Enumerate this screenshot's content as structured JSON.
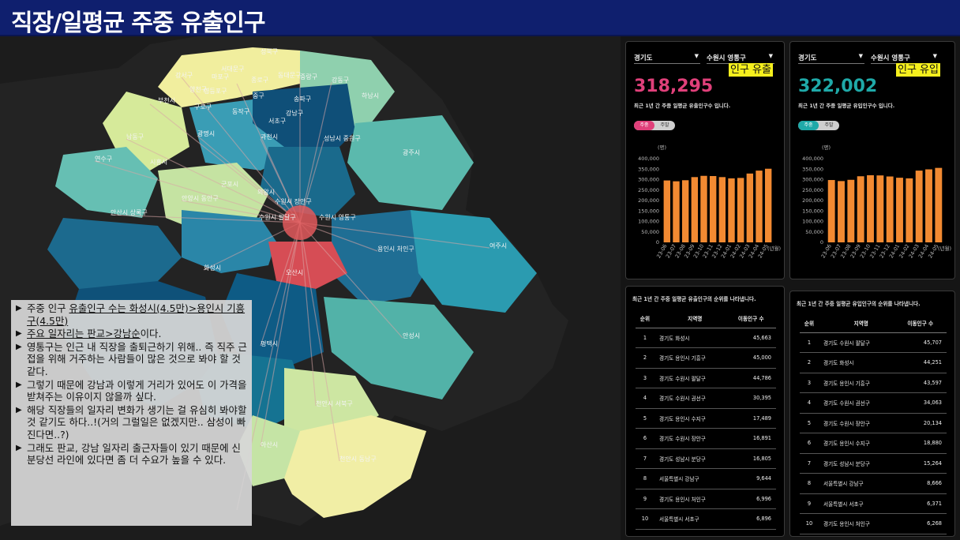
{
  "banner": {
    "title": "직장/일평균 주중 유출인구"
  },
  "map": {
    "labels": [
      "성북구",
      "강서구",
      "서대문구",
      "마포구",
      "종로구",
      "동대문구",
      "중랑구",
      "강동구",
      "영등포구",
      "부천시",
      "양천구",
      "구로구",
      "중구",
      "송파구",
      "하남시",
      "동작구",
      "강남구",
      "서초구",
      "남동구",
      "광명시",
      "과천시",
      "성남시 중원구",
      "연수구",
      "시흥시",
      "광주시",
      "안양시 동안구",
      "군포시",
      "의왕시",
      "안산시 상록구",
      "수원시 장안구",
      "수원시 팔달구",
      "수원시 영통구",
      "화성시",
      "용인시 처인구",
      "여주시",
      "오산시",
      "평택시",
      "안성시",
      "천안시 서북구",
      "천안시 동남구",
      "아산시"
    ],
    "colors": {
      "hub": "#e2595c",
      "flow": "#d9a6a6"
    }
  },
  "notes": {
    "items": [
      [
        "주중 인구 ",
        "유출인구 수는 화성시(4.5만)>용인시 기흥구(4.5만)"
      ],
      [
        "",
        "주요 일자리는 판교>강남순",
        "이다."
      ],
      [
        "영통구는 인근 내 직장을 출퇴근하기 위해.. 즉 직주 근접을 위해 거주하는 사람들이 많은 것으로 봐야 할 것 같다."
      ],
      [
        "그렇기 때문에 강남과 이렇게 거리가 있어도 이 가격을 받쳐주는 이유이지 않을까 싶다."
      ],
      [
        "해당 직장들의 일자리 변화가 생기는 걸 유심히 봐야할 것 같기도 하다..!(거의 그럴일은 없겠지만.. 삼성이 빠진다면..?)"
      ],
      [
        "그래도 판교, 강남 일자리 출근자들이 있기 때문에 신분당선 라인에 있다면 좀 더 수요가 높을 수 있다."
      ]
    ]
  },
  "outflow": {
    "province": "경기도",
    "district": "수원시 영통구",
    "tag": "인구 유출",
    "number": "318,295",
    "desc": "최근 1년 간 주중 일평균 유출인구수 입니다.",
    "toggle_on": "주중",
    "toggle_off": "주말",
    "accent": "#e0407a",
    "ranking_title": "최근 1년 간 주중 일평균 유출인구의 순위를 나타냅니다.",
    "headers": [
      "순위",
      "지역명",
      "이동인구 수"
    ],
    "rows": [
      [
        "1",
        "경기도 화성시",
        "45,663"
      ],
      [
        "2",
        "경기도 용인시 기흥구",
        "45,000"
      ],
      [
        "3",
        "경기도 수원시 팔달구",
        "44,786"
      ],
      [
        "4",
        "경기도 수원시 권선구",
        "30,395"
      ],
      [
        "5",
        "경기도 용인시 수지구",
        "17,489"
      ],
      [
        "6",
        "경기도 수원시 장안구",
        "16,891"
      ],
      [
        "7",
        "경기도 성남시 분당구",
        "16,805"
      ],
      [
        "8",
        "서울특별시 강남구",
        "9,644"
      ],
      [
        "9",
        "경기도 용인시 처인구",
        "6,996"
      ],
      [
        "10",
        "서울특별시 서초구",
        "6,896"
      ]
    ]
  },
  "inflow": {
    "province": "경기도",
    "district": "수원시 영통구",
    "tag": "인구 유입",
    "number": "322,002",
    "desc": "최근 1년 간 주중 일평균 유입인구수 입니다.",
    "toggle_on": "주중",
    "toggle_off": "주말",
    "accent": "#1fa9a8",
    "ranking_title": "최근 1년 간 주중 일평균 유입인구의 순위를 나타냅니다.",
    "headers": [
      "순위",
      "지역명",
      "이동인구 수"
    ],
    "rows": [
      [
        "1",
        "경기도 수원시 팔달구",
        "45,707"
      ],
      [
        "2",
        "경기도 화성시",
        "44,251"
      ],
      [
        "3",
        "경기도 용인시 기흥구",
        "43,597"
      ],
      [
        "4",
        "경기도 수원시 권선구",
        "34,063"
      ],
      [
        "5",
        "경기도 수원시 장안구",
        "20,134"
      ],
      [
        "6",
        "경기도 용인시 수지구",
        "18,880"
      ],
      [
        "7",
        "경기도 성남시 분당구",
        "15,264"
      ],
      [
        "8",
        "서울특별시 강남구",
        "8,666"
      ],
      [
        "9",
        "서울특별시 서초구",
        "6,371"
      ],
      [
        "10",
        "경기도 용인시 처인구",
        "6,268"
      ]
    ]
  },
  "chart_data": [
    {
      "type": "bar",
      "ylabel": "(명)",
      "xlabel": "(년월)",
      "ylim": [
        0,
        400000
      ],
      "yticks": [
        "0",
        "50,000",
        "100,000",
        "150,000",
        "200,000",
        "250,000",
        "300,000",
        "350,000",
        "400,000"
      ],
      "categories": [
        "23-06",
        "23-07",
        "23-08",
        "23-09",
        "23-10",
        "23-11",
        "23-12",
        "24-01",
        "24-02",
        "24-03",
        "24-04",
        "24-05"
      ],
      "values": [
        296000,
        292000,
        297000,
        312000,
        318000,
        317000,
        312000,
        306000,
        308000,
        329000,
        343000,
        352000
      ],
      "color": "#f28a32"
    },
    {
      "type": "bar",
      "ylabel": "(명)",
      "xlabel": "(년월)",
      "ylim": [
        0,
        400000
      ],
      "yticks": [
        "0",
        "50,000",
        "100,000",
        "150,000",
        "200,000",
        "250,000",
        "300,000",
        "350,000",
        "400,000"
      ],
      "categories": [
        "23-06",
        "23-07",
        "23-08",
        "23-09",
        "23-10",
        "23-11",
        "23-12",
        "24-01",
        "24-02",
        "24-03",
        "24-04",
        "24-05"
      ],
      "values": [
        298000,
        293000,
        299000,
        316000,
        321000,
        320000,
        315000,
        309000,
        306000,
        343000,
        349000,
        356000
      ],
      "color": "#f28a32"
    }
  ]
}
